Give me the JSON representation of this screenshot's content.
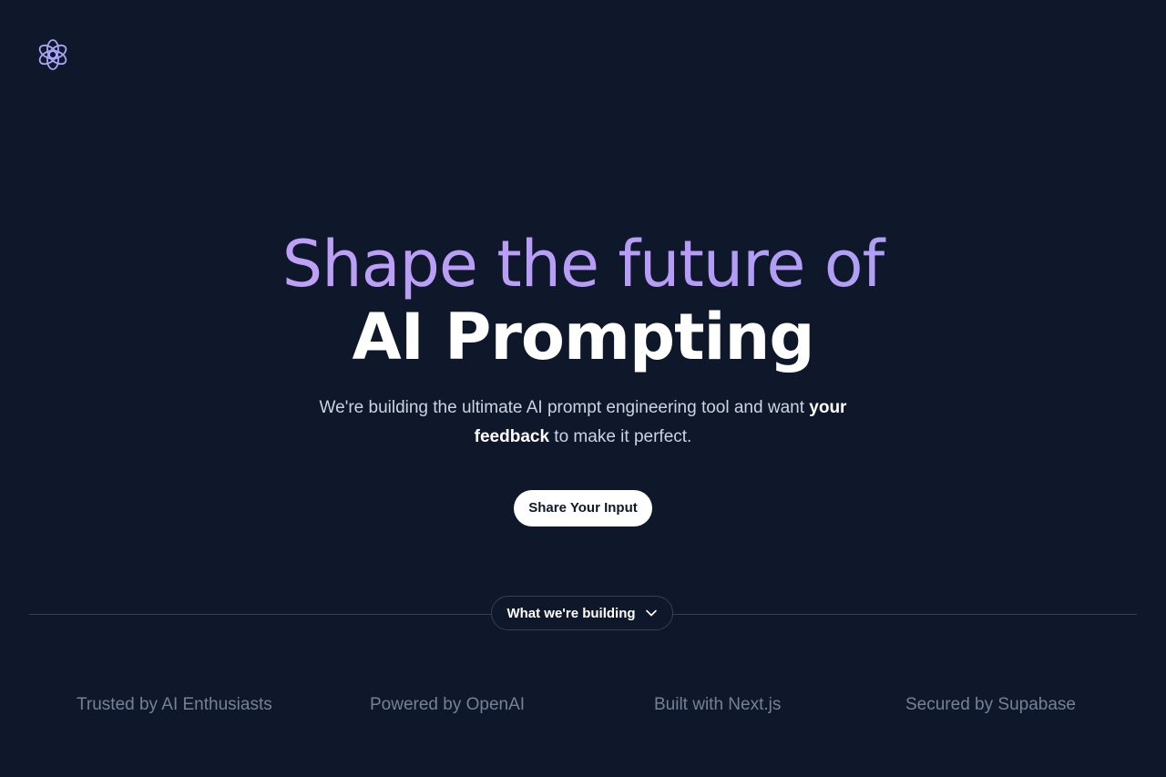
{
  "logo": {
    "icon": "openai-logo-icon",
    "color": "#a9a4f4"
  },
  "hero": {
    "headline_line1": "Shape the future of",
    "headline_line2": "AI Prompting",
    "subtitle_prefix": "We're building the ultimate AI prompt engineering tool and want ",
    "subtitle_emphasis": "your feedback",
    "subtitle_suffix": " to make it perfect.",
    "cta_label": "Share Your Input"
  },
  "section_toggle": {
    "label": "What we're building",
    "icon": "chevron-down-icon"
  },
  "footer": {
    "items": [
      "Trusted by AI Enthusiasts",
      "Powered by OpenAI",
      "Built with Next.js",
      "Secured by Supabase"
    ]
  },
  "colors": {
    "background": "#0f172a",
    "accent": "#b79cf6",
    "muted_text": "#748297"
  }
}
